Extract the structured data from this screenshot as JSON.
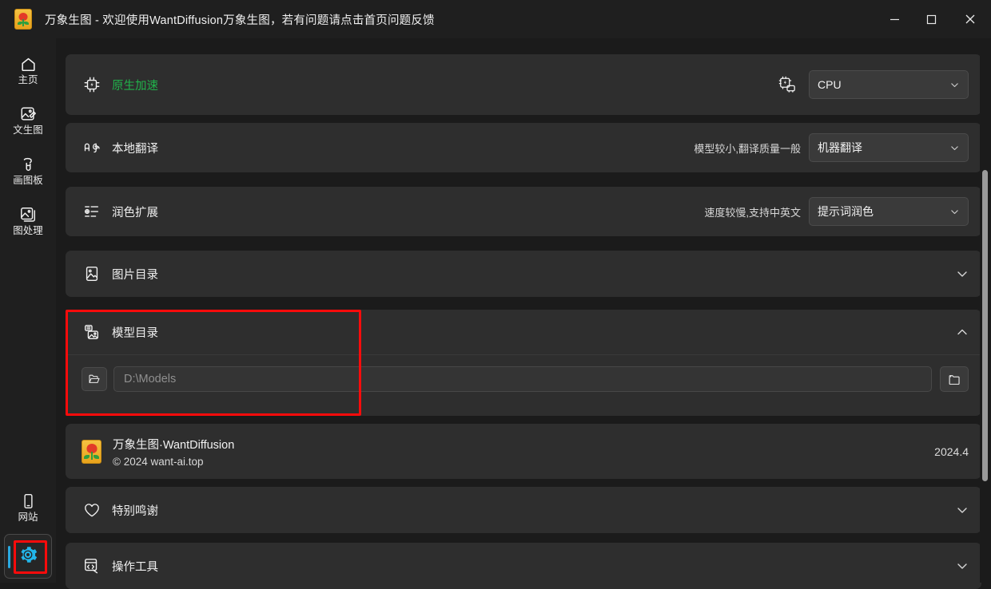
{
  "window": {
    "app_icon": "flower-app-icon",
    "title": "万象生图  -  欢迎使用WantDiffusion万象生图，若有问题请点击首页问题反馈",
    "minimize_label": "minimize-icon",
    "maximize_label": "maximize-icon",
    "close_label": "close-icon"
  },
  "sidebar": {
    "top_items": [
      {
        "label": "主页",
        "icon": "home-icon"
      },
      {
        "label": "文生图",
        "icon": "text-to-image-icon"
      },
      {
        "label": "画图板",
        "icon": "draw-board-icon"
      },
      {
        "label": "图处理",
        "icon": "image-process-icon"
      }
    ],
    "bottom_items": [
      {
        "label": "网站",
        "icon": "mobile-website-icon"
      }
    ],
    "settings": {
      "icon": "gear-icon",
      "selected": true,
      "accent": "#2aa8e0",
      "highlight": "#fb0b0b"
    }
  },
  "settings_rows": [
    {
      "id": "native-accel",
      "icon": "cpu-chip-icon",
      "label": "原生加速",
      "label_color": "#21b24b",
      "hint": "",
      "control": "dropdown",
      "control_icon": "cpu-device-icon",
      "value": "CPU"
    },
    {
      "id": "local-translate",
      "icon": "translate-icon",
      "label": "本地翻译",
      "label_color": "#f0f0f0",
      "hint": "模型较小,翻译质量一般",
      "control": "dropdown",
      "value": "机器翻译"
    },
    {
      "id": "polish-extension",
      "icon": "polish-list-icon",
      "label": "润色扩展",
      "label_color": "#f0f0f0",
      "hint": "速度较慢,支持中英文",
      "control": "dropdown",
      "value": "提示词润色"
    },
    {
      "id": "image-directory",
      "icon": "image-folder-icon",
      "label": "图片目录",
      "label_color": "#f0f0f0",
      "hint": "",
      "control": "expander",
      "expanded": false,
      "caret": "chevron-down-icon"
    },
    {
      "id": "model-directory",
      "icon": "model-folder-icon",
      "label": "模型目录",
      "label_color": "#f0f0f0",
      "hint": "",
      "control": "expander",
      "expanded": true,
      "caret": "chevron-up-icon",
      "path_placeholder": "D:\\Models",
      "path_value": "",
      "open_folder_icon": "folder-open-icon",
      "browse_icon": "folder-icon",
      "highlighted": true
    }
  ],
  "about": {
    "icon": "flower-app-icon",
    "name": "万象生图·WantDiffusion",
    "copyright": "© 2024 want-ai.top",
    "version": "2024.4"
  },
  "footer_rows": [
    {
      "id": "special-thanks",
      "icon": "heart-icon",
      "label": "特别鸣谢",
      "caret": "chevron-down-icon"
    },
    {
      "id": "operation-tools",
      "icon": "tools-icon",
      "label": "操作工具",
      "caret": "chevron-down-icon"
    }
  ],
  "scrollbar": {
    "orientation": "vertical"
  }
}
